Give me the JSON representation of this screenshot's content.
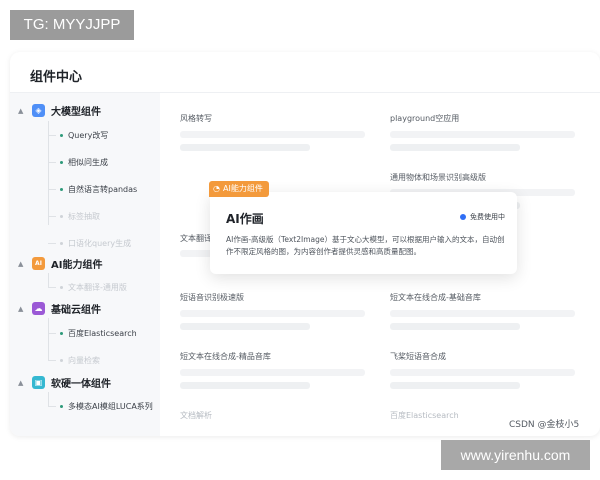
{
  "overlay": {
    "tg_label": "TG: MYYJJPP",
    "site_label": "www.yirenhu.com",
    "watermark": "CSDN @金枝小5"
  },
  "panel": {
    "title": "组件中心"
  },
  "sidebar": {
    "groups": [
      {
        "label": "大模型组件",
        "color": "#4f8ff7",
        "icon": "cube-icon",
        "glyph": "◈",
        "items": [
          {
            "label": "Query改写",
            "faded": false
          },
          {
            "label": "相似问生成",
            "faded": false
          },
          {
            "label": "自然语言转pandas",
            "faded": false
          },
          {
            "label": "标签抽取",
            "faded": true
          },
          {
            "label": "口语化query生成",
            "faded": true
          }
        ]
      },
      {
        "label": "AI能力组件",
        "color": "#f39a3c",
        "icon": "ai-icon",
        "glyph": "AI",
        "items": [
          {
            "label": "文本翻译-通用版",
            "faded": true
          }
        ]
      },
      {
        "label": "基础云组件",
        "color": "#9b59d6",
        "icon": "cloud-icon",
        "glyph": "☁",
        "items": [
          {
            "label": "百度Elasticsearch",
            "faded": false
          },
          {
            "label": "向量检索",
            "faded": true
          }
        ]
      },
      {
        "label": "软硬一体组件",
        "color": "#35b8d1",
        "icon": "chip-icon",
        "glyph": "▣",
        "items": [
          {
            "label": "多模态AI模组LUCA系列",
            "faded": false
          }
        ]
      }
    ]
  },
  "grid": {
    "cells": [
      {
        "title": "风格转写",
        "faded": false
      },
      {
        "title": "playground空应用",
        "faded": false
      },
      {
        "title": "",
        "faded": false
      },
      {
        "title": "通用物体和场景识别高级版",
        "faded": false
      },
      {
        "title": "文本翻译",
        "faded": false
      },
      {
        "title": "",
        "faded": false
      },
      {
        "title": "短语音识别极速版",
        "faded": false
      },
      {
        "title": "短文本在线合成-基础音库",
        "faded": false
      },
      {
        "title": "短文本在线合成-精品音库",
        "faded": false
      },
      {
        "title": "飞桨短语音合成",
        "faded": false
      },
      {
        "title": "文档解析",
        "faded": true
      },
      {
        "title": "百度Elasticsearch",
        "faded": true
      }
    ]
  },
  "popup": {
    "tag": "AI能力组件",
    "title": "AI作画",
    "badge": "免费使用中",
    "description": "AI作画-高级版（Text2Image）基于文心大模型，可以根据用户输入的文本，自动创作不限定风格的图，为内容创作者提供灵感和高质量配图。"
  }
}
